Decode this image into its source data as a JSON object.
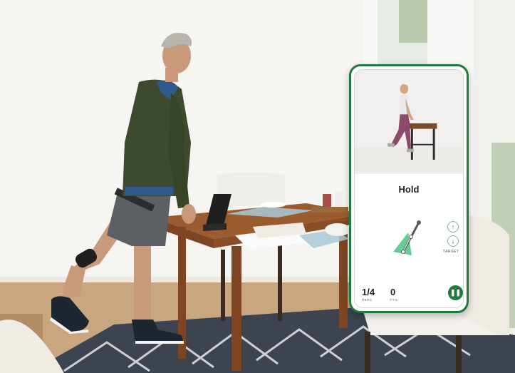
{
  "app": {
    "exercise_status": "Hold",
    "reps_value": "1/4",
    "reps_label": "REPS",
    "points_value": "0",
    "points_label": "PTS",
    "target_label": "TARGET"
  },
  "icons": {
    "pause": "pause-icon",
    "target_up": "chevron-up-icon",
    "target_down": "chevron-down-icon"
  },
  "colors": {
    "brand_green": "#1f7a3c",
    "gauge_green": "#54c78a"
  }
}
